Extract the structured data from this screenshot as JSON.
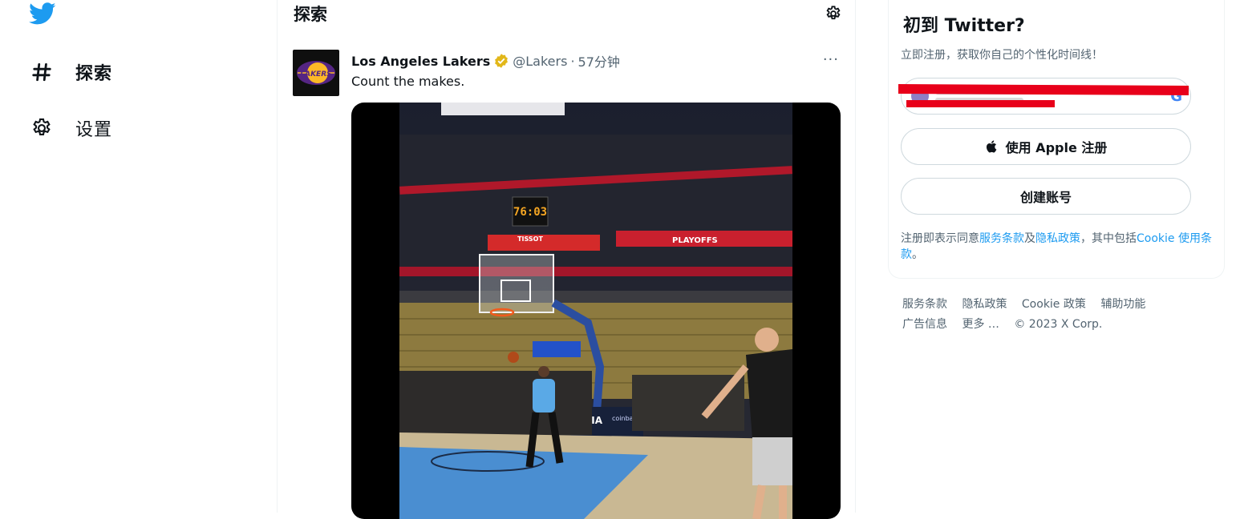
{
  "nav": {
    "logo": "twitter-bird-icon",
    "items": [
      {
        "icon": "hashtag-icon",
        "label": "探索"
      },
      {
        "icon": "gear-icon",
        "label": "设置"
      }
    ]
  },
  "main": {
    "header": "探索",
    "tweet": {
      "name": "Los Angeles Lakers",
      "handle": "@Lakers",
      "dot": "·",
      "time": "57分钟",
      "text": "Count the makes.",
      "more": "···",
      "avatar_text": "LAKERS",
      "media": {
        "shot_clock": "76:03",
        "banner_text": "PLAYOFFS",
        "sponsor": "KIA",
        "sponsor2": "coinbase",
        "board_text": "TISSOT"
      }
    }
  },
  "sidebar": {
    "title": "初到 Twitter?",
    "subtitle": "立即注册，获取你自己的个性化时间线！",
    "google_logo": "G",
    "apple_button": "使用 Apple 注册",
    "create_button": "创建账号",
    "terms": {
      "prefix": "注册即表示同意",
      "tos": "服务条款",
      "and": "及",
      "privacy": "隐私政策",
      "mid": "，其中包括",
      "cookie": "Cookie 使用条款",
      "end": "。"
    },
    "footer": {
      "links": [
        "服务条款",
        "隐私政策",
        "Cookie 政策",
        "辅助功能",
        "广告信息",
        "更多 …"
      ],
      "copyright": "© 2023 X Corp."
    }
  },
  "colors": {
    "brand": "#1d9bf0",
    "text": "#0f1419",
    "muted": "#536471",
    "verified_gold": "#e2b719",
    "redaction": "#e8001a"
  }
}
